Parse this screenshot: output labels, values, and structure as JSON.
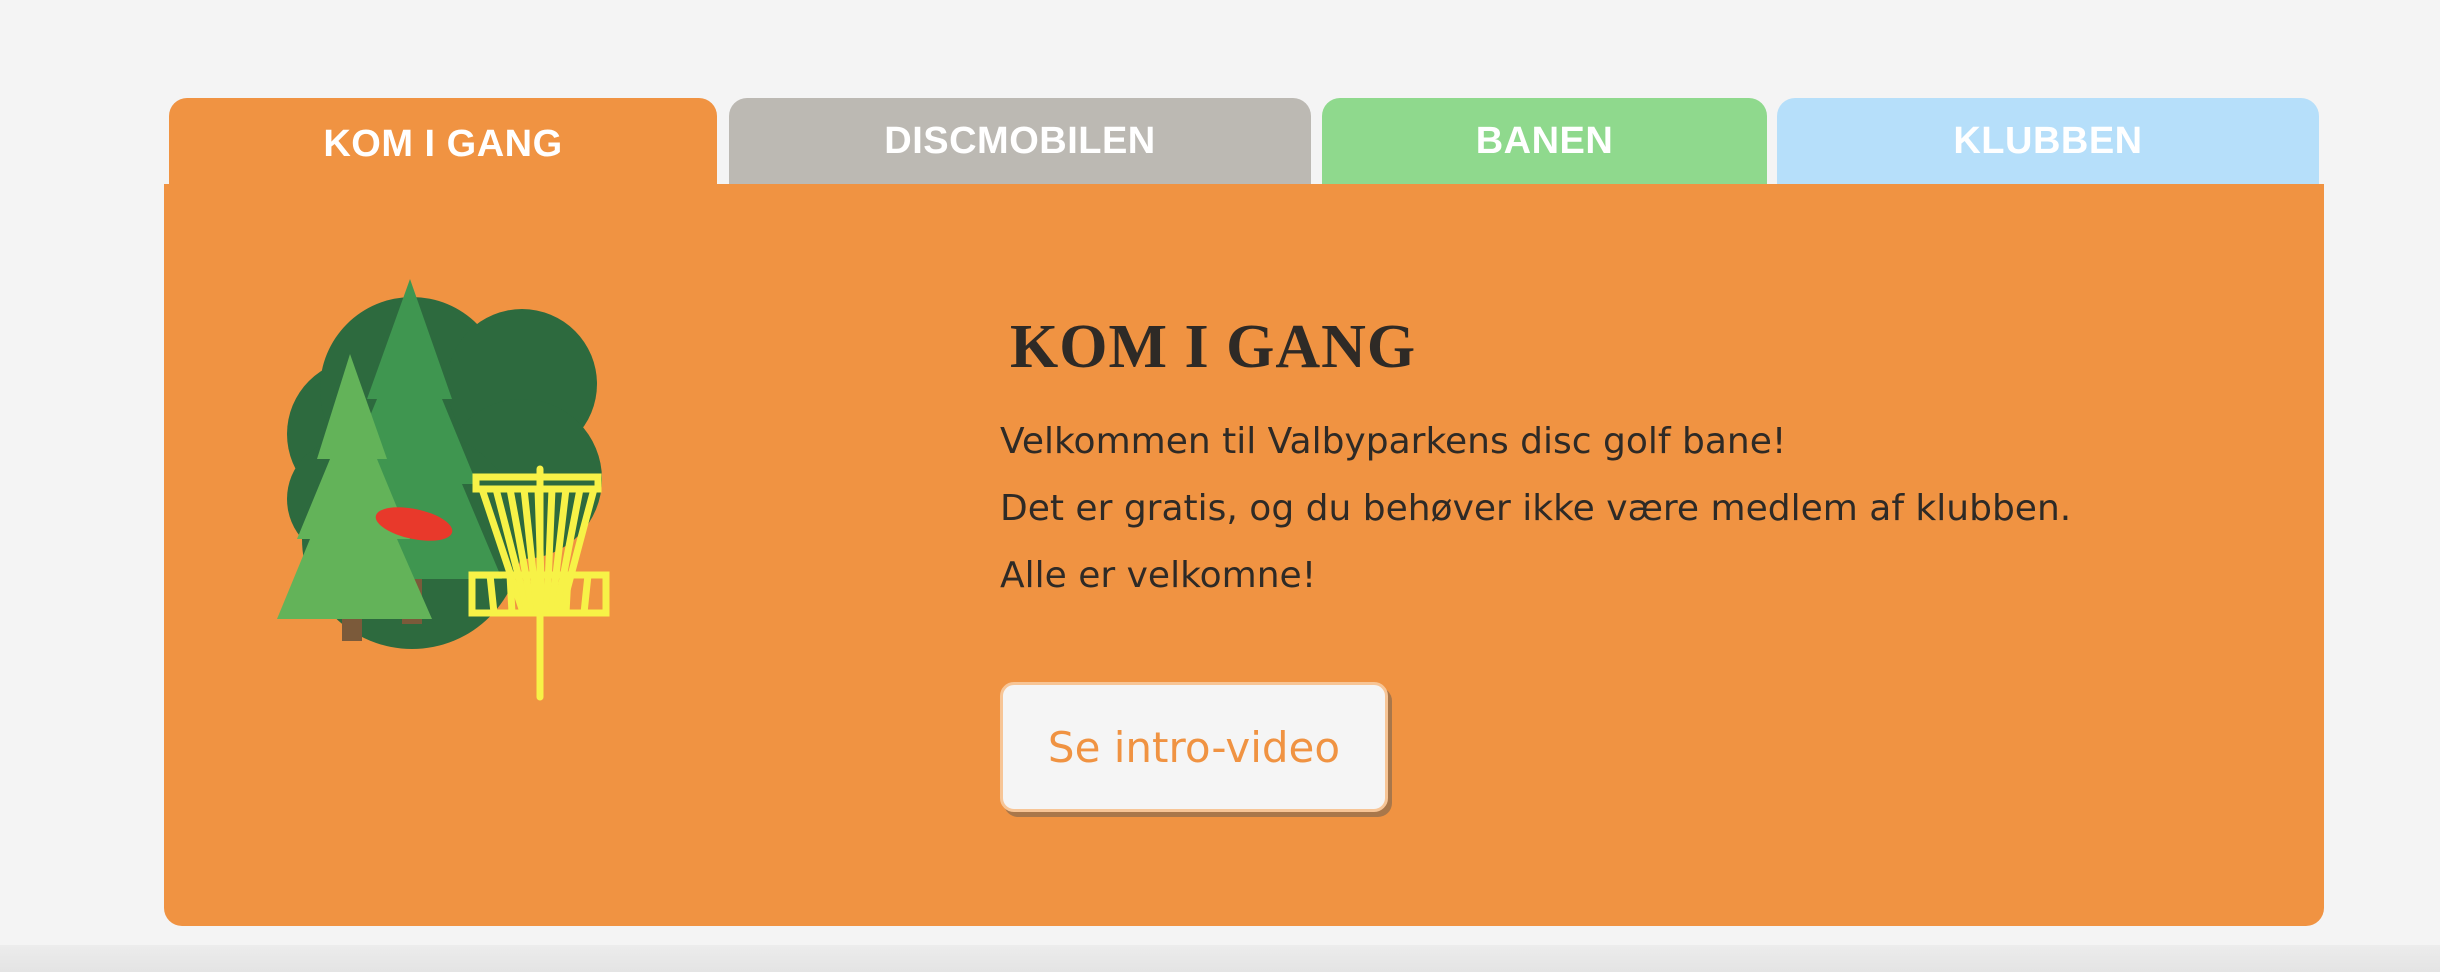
{
  "tabs": [
    {
      "label": "KOM I GANG",
      "color": "#f09342",
      "active": true
    },
    {
      "label": "DISCMOBILEN",
      "color": "#bcb9b3",
      "active": false
    },
    {
      "label": "BANEN",
      "color": "#8fd98d",
      "active": false
    },
    {
      "label": "KLUBBEN",
      "color": "#b6dffa",
      "active": false
    }
  ],
  "panel": {
    "background": "#f09342",
    "illustration": {
      "icons": [
        "tree-icon",
        "disc-icon",
        "disc-golf-basket-icon"
      ],
      "colors": {
        "bush": "#2d6a3e",
        "tree_back": "#3f9650",
        "tree_front": "#63b359",
        "trunk": "#7b5a3a",
        "disc": "#e8392b",
        "basket": "#f7f247"
      }
    },
    "heading": "KOM I GANG",
    "lines": [
      "Velkommen til Valbyparkens disc golf bane!",
      "Det er gratis, og du behøver ikke være medlem af klubben.",
      "Alle er velkomne!"
    ],
    "button_label": "Se intro-video"
  }
}
